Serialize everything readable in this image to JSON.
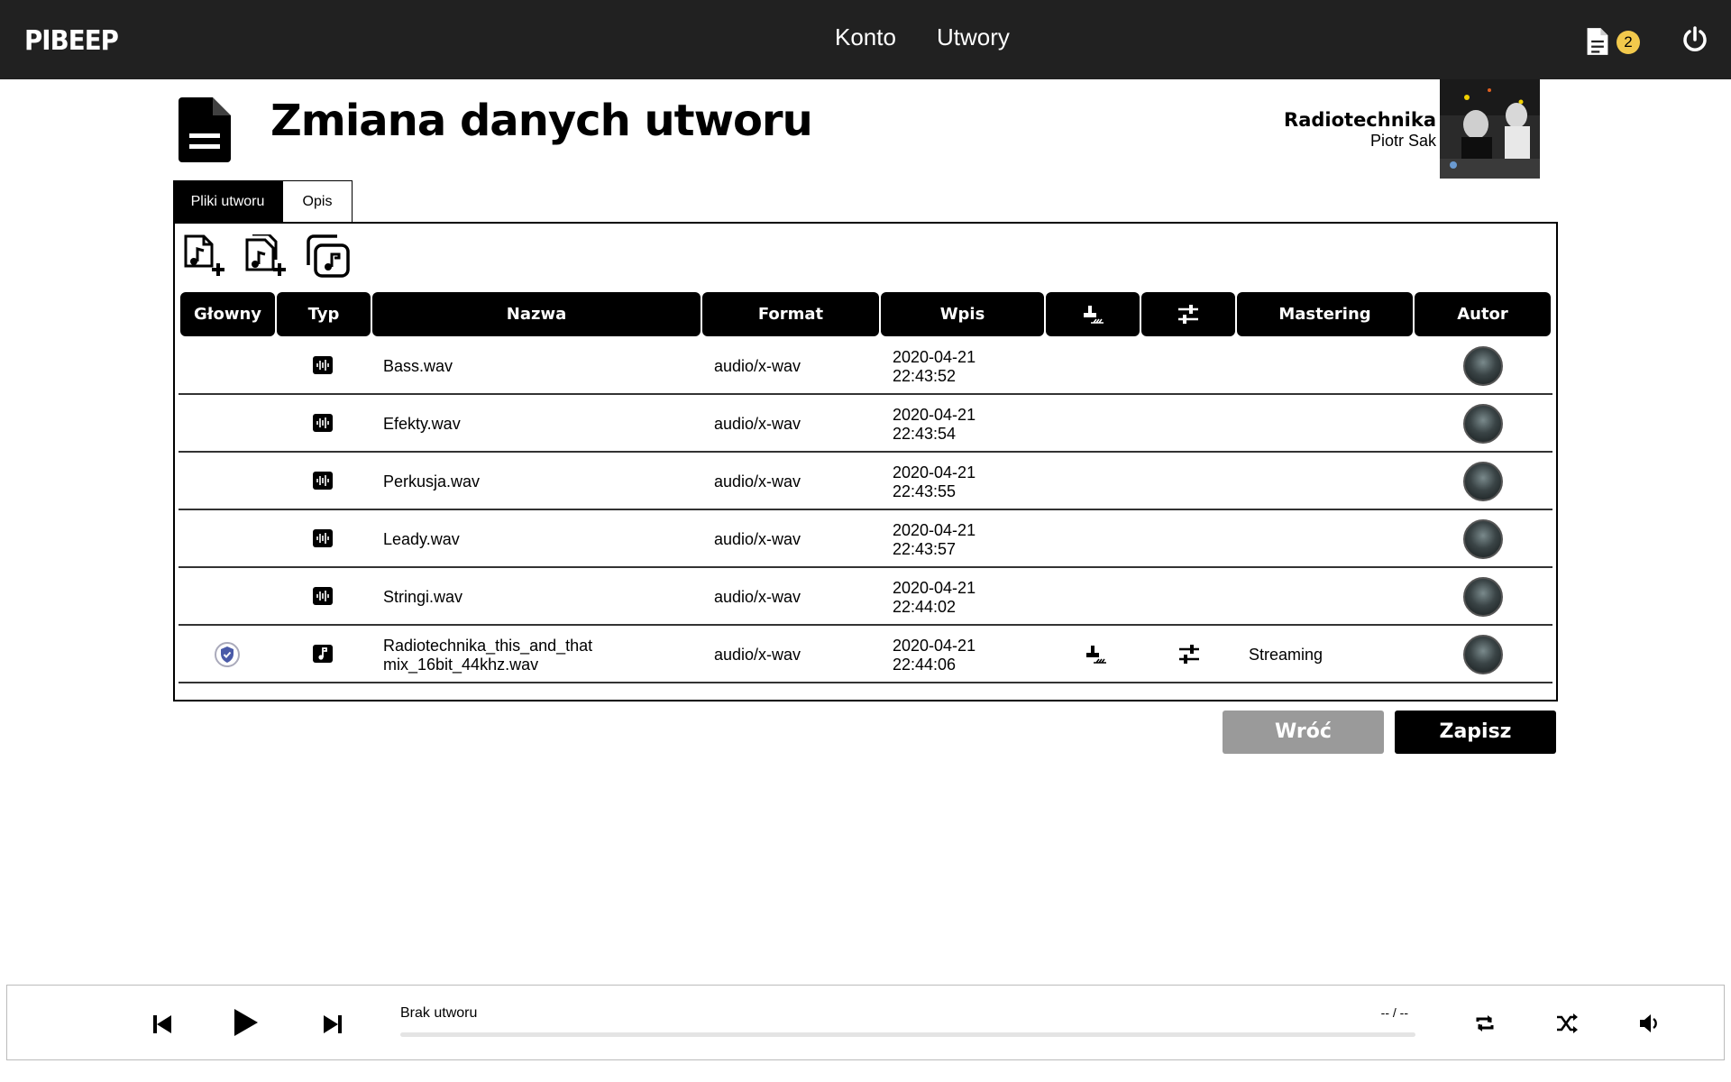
{
  "app": {
    "logo": "PIBEEP",
    "nav": [
      "Konto",
      "Utwory"
    ],
    "notifications_count": "2",
    "icons": {
      "documents": "document-icon",
      "power": "power-icon"
    }
  },
  "header": {
    "title": "Zmiana danych utworu",
    "song_title": "Radiotechnika",
    "song_artist": "Piotr Sak"
  },
  "tabs": [
    {
      "label": "Pliki utworu",
      "active": true
    },
    {
      "label": "Opis",
      "active": false
    }
  ],
  "toolbar": {
    "icons": [
      "add-audio-file-icon",
      "add-multiple-audio-files-icon",
      "music-library-icon"
    ]
  },
  "table": {
    "columns": [
      "Głowny",
      "Typ",
      "Nazwa",
      "Format",
      "Wpis",
      "",
      "",
      "Mastering",
      "Autor"
    ],
    "column_icons": {
      "5": "stamp-icon",
      "6": "sliders-icon"
    },
    "rows": [
      {
        "main": false,
        "type": "waveform",
        "name_line1": "Bass.wav",
        "name_line2": "",
        "format": "audio/x-wav",
        "date": "2020-04-21",
        "time": "22:43:52",
        "stamp": false,
        "mix": false,
        "mastering": ""
      },
      {
        "main": false,
        "type": "waveform",
        "name_line1": "Efekty.wav",
        "name_line2": "",
        "format": "audio/x-wav",
        "date": "2020-04-21",
        "time": "22:43:54",
        "stamp": false,
        "mix": false,
        "mastering": ""
      },
      {
        "main": false,
        "type": "waveform",
        "name_line1": "Perkusja.wav",
        "name_line2": "",
        "format": "audio/x-wav",
        "date": "2020-04-21",
        "time": "22:43:55",
        "stamp": false,
        "mix": false,
        "mastering": ""
      },
      {
        "main": false,
        "type": "waveform",
        "name_line1": "Leady.wav",
        "name_line2": "",
        "format": "audio/x-wav",
        "date": "2020-04-21",
        "time": "22:43:57",
        "stamp": false,
        "mix": false,
        "mastering": ""
      },
      {
        "main": false,
        "type": "waveform",
        "name_line1": "Stringi.wav",
        "name_line2": "",
        "format": "audio/x-wav",
        "date": "2020-04-21",
        "time": "22:44:02",
        "stamp": false,
        "mix": false,
        "mastering": ""
      },
      {
        "main": true,
        "type": "music-note",
        "name_line1": "Radiotechnika_this_and_that",
        "name_line2": "mix_16bit_44khz.wav",
        "format": "audio/x-wav",
        "date": "2020-04-21",
        "time": "22:44:06",
        "stamp": true,
        "mix": true,
        "mastering": "Streaming"
      }
    ]
  },
  "actions": {
    "back": "Wróć",
    "save": "Zapisz"
  },
  "player": {
    "track": "Brak utworu",
    "time": "-- / --",
    "progress": 0,
    "icons": [
      "previous-icon",
      "play-icon",
      "next-icon",
      "repeat-icon",
      "shuffle-icon",
      "volume-icon"
    ]
  }
}
